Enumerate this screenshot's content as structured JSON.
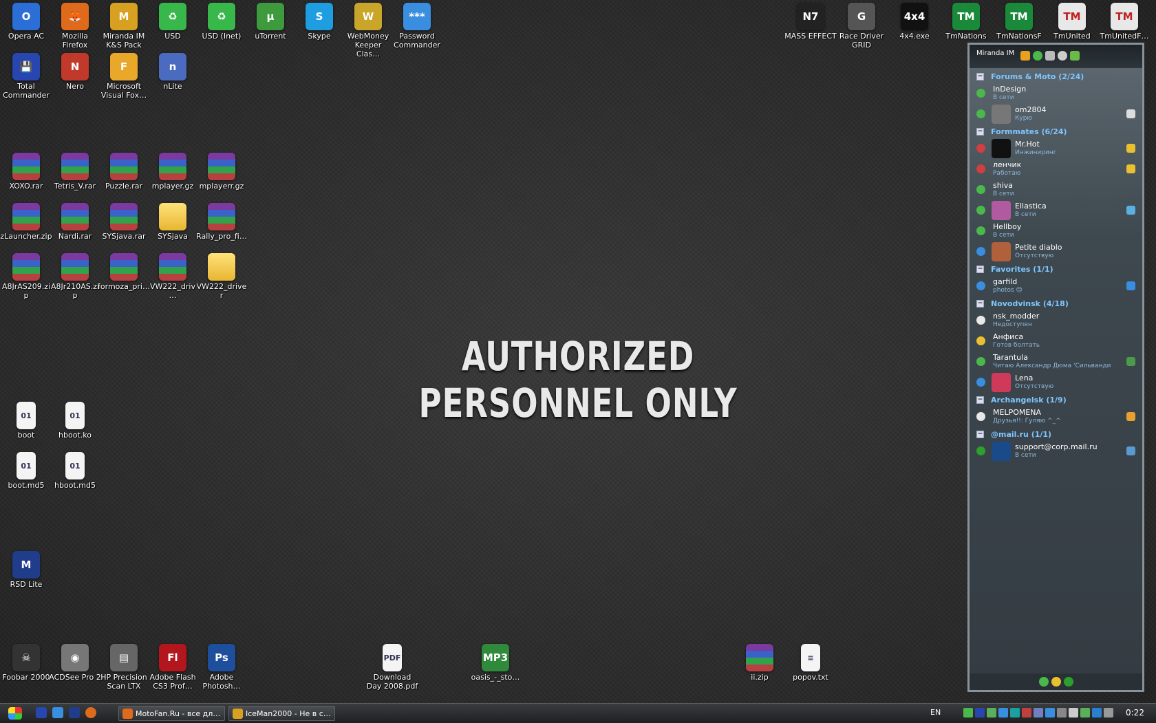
{
  "wallpaper": {
    "text": "AUTHORIZED PERSONNEL ONLY"
  },
  "desktop_icons": [
    {
      "label": "Opera AC",
      "glyph": "O",
      "color": "#2b6fd6"
    },
    {
      "label": "Mozilla Firefox",
      "glyph": "🦊",
      "color": "#e06a1b"
    },
    {
      "label": "Miranda IM K&S Pack",
      "glyph": "M",
      "color": "#d8a020"
    },
    {
      "label": "USD",
      "glyph": "♻",
      "color": "#38b84a"
    },
    {
      "label": "USD (Inet)",
      "glyph": "♻",
      "color": "#38b84a"
    },
    {
      "label": "uTorrent",
      "glyph": "µ",
      "color": "#3d9a3d"
    },
    {
      "label": "Skype",
      "glyph": "S",
      "color": "#1e9de0"
    },
    {
      "label": "WebMoney Keeper Clas…",
      "glyph": "W",
      "color": "#c9a52a"
    },
    {
      "label": "Password Commander",
      "glyph": "***",
      "color": "#3a8ee0"
    },
    {
      "label": "Total Commander",
      "glyph": "💾",
      "color": "#2746b0"
    },
    {
      "label": "Nero",
      "glyph": "N",
      "color": "#c0392b"
    },
    {
      "label": "Microsoft Visual Fox…",
      "glyph": "F",
      "color": "#e9a82a"
    },
    {
      "label": "nLite",
      "glyph": "n",
      "color": "#4a6bbf"
    },
    {
      "label": "MASS EFFECT",
      "glyph": "N7",
      "color": "#222222"
    },
    {
      "label": "Race Driver GRID",
      "glyph": "G",
      "color": "#555555"
    },
    {
      "label": "4x4.exe",
      "glyph": "4x4",
      "color": "#111111"
    },
    {
      "label": "TmNations",
      "glyph": "TM",
      "color": "#1a8a3a"
    },
    {
      "label": "TmNationsF…",
      "glyph": "TM",
      "color": "#1a8a3a"
    },
    {
      "label": "TmUnited",
      "glyph": "TM",
      "color": "#e8e8e8"
    },
    {
      "label": "TmUnitedF…",
      "glyph": "TM",
      "color": "#e8e8e8"
    },
    {
      "label": "XOXO.rar",
      "type": "archive"
    },
    {
      "label": "Tetris_V.rar",
      "type": "archive"
    },
    {
      "label": "Puzzle.rar",
      "type": "archive"
    },
    {
      "label": "mplayer.gz",
      "type": "archive"
    },
    {
      "label": "mplayerr.gz",
      "type": "archive"
    },
    {
      "label": "zLauncher.zip",
      "type": "archive"
    },
    {
      "label": "Nardi.rar",
      "type": "archive"
    },
    {
      "label": "SYSjava.rar",
      "type": "archive"
    },
    {
      "label": "SYSjava",
      "type": "folder"
    },
    {
      "label": "Rally_pro_fi…",
      "type": "archive"
    },
    {
      "label": "A8JrAS209.zip",
      "type": "archive"
    },
    {
      "label": "A8Jr210AS.zip",
      "type": "archive"
    },
    {
      "label": "formoza_pri…",
      "type": "archive"
    },
    {
      "label": "VW222_driv…",
      "type": "archive"
    },
    {
      "label": "VW222_driver",
      "type": "folder"
    },
    {
      "label": "boot",
      "type": "doc",
      "glyph": "01"
    },
    {
      "label": "hboot.ko",
      "type": "doc",
      "glyph": "01"
    },
    {
      "label": "boot.md5",
      "type": "doc",
      "glyph": "01"
    },
    {
      "label": "hboot.md5",
      "type": "doc",
      "glyph": "01"
    },
    {
      "label": "RSD Lite",
      "glyph": "M",
      "color": "#1f3d8a"
    },
    {
      "label": "Foobar 2000",
      "glyph": "☠",
      "color": "#333333"
    },
    {
      "label": "ACDSee Pro 2",
      "glyph": "◉",
      "color": "#777777"
    },
    {
      "label": "HP Precision Scan LTX",
      "glyph": "▤",
      "color": "#666666"
    },
    {
      "label": "Adobe Flash CS3 Prof…",
      "glyph": "Fl",
      "color": "#b3161c"
    },
    {
      "label": "Adobe Photosh…",
      "glyph": "Ps",
      "color": "#1d4f9c"
    },
    {
      "label": "Download Day 2008.pdf",
      "type": "doc",
      "glyph": "PDF"
    },
    {
      "label": "oasis_-_sto…",
      "glyph": "MP3",
      "color": "#2f8a3b"
    },
    {
      "label": "ii.zip",
      "type": "archive"
    },
    {
      "label": "popov.txt",
      "type": "doc",
      "glyph": "≡"
    }
  ],
  "miranda": {
    "title": "Miranda IM",
    "groups": [
      {
        "name": "Forums & Moto  (2/24)",
        "contacts": [
          {
            "name": "InDesign",
            "status": "В сети",
            "state": "online",
            "avatar": null
          },
          {
            "name": "om2804",
            "status": "Курю",
            "state": "online",
            "avatar": "#777",
            "extra": "#ddd"
          }
        ]
      },
      {
        "name": "Formmates  (6/24)",
        "contacts": [
          {
            "name": "Mr.Hot",
            "status": "Инжиниринг",
            "state": "dnd",
            "avatar": "#111",
            "extra": "#e8c030"
          },
          {
            "name": "ленчик",
            "status": "Работаю",
            "state": "dnd",
            "avatar": null,
            "extra": "#e8c030"
          },
          {
            "name": "shiva",
            "status": "В сети",
            "state": "online",
            "avatar": null
          },
          {
            "name": "Ellastica",
            "status": "В сети",
            "state": "online",
            "avatar": "#b05aa0",
            "extra": "#5ab0e0"
          },
          {
            "name": "Hellboy",
            "status": "В сети",
            "state": "online",
            "avatar": null
          },
          {
            "name": "Petite diablo",
            "status": "Отсутствую",
            "state": "away",
            "avatar": "#b0603a"
          }
        ]
      },
      {
        "name": "Favorites  (1/1)",
        "contacts": [
          {
            "name": "garfild",
            "status": "photos 😊",
            "state": "away",
            "avatar": null,
            "extra": "#3a8ee0"
          }
        ]
      },
      {
        "name": "Novodvinsk  (4/18)",
        "contacts": [
          {
            "name": "nsk_modder",
            "status": "Недоступен",
            "state": "na",
            "avatar": null
          },
          {
            "name": "Анфиса",
            "status": "Готов болтать",
            "state": "chat",
            "avatar": null
          },
          {
            "name": "Tarantula",
            "status": "Читаю Александр Дюма 'Сильвандир'",
            "state": "online",
            "avatar": null,
            "extra": "#4a9a4a"
          },
          {
            "name": "Lena",
            "status": "Отсутствую",
            "state": "away",
            "avatar": "#d03a5a"
          }
        ]
      },
      {
        "name": "Archangelsk  (1/9)",
        "contacts": [
          {
            "name": "MELPOMENA",
            "status": "Друзья!!: Гуляю ^_^",
            "state": "na",
            "avatar": null,
            "extra": "#e8a030"
          }
        ]
      },
      {
        "name": "@mail.ru  (1/1)",
        "contacts": [
          {
            "name": "support@corp.mail.ru",
            "status": "В сети",
            "state": "mail",
            "avatar": "#1a4a8a",
            "extra": "#5a9ad0"
          }
        ]
      }
    ]
  },
  "taskbar": {
    "tasks": [
      {
        "label": "MotoFan.Ru - все дл…",
        "color": "#e06a1b"
      },
      {
        "label": "IceMan2000 - Не в с…",
        "color": "#d8a020"
      }
    ],
    "language": "EN",
    "clock": "0:22"
  },
  "colors": {
    "online": "#4ab84a",
    "away": "#3a8ee0",
    "dnd": "#d04040",
    "na": "#e8e8e8",
    "chat": "#e8c030",
    "mail": "#2ca02c"
  }
}
